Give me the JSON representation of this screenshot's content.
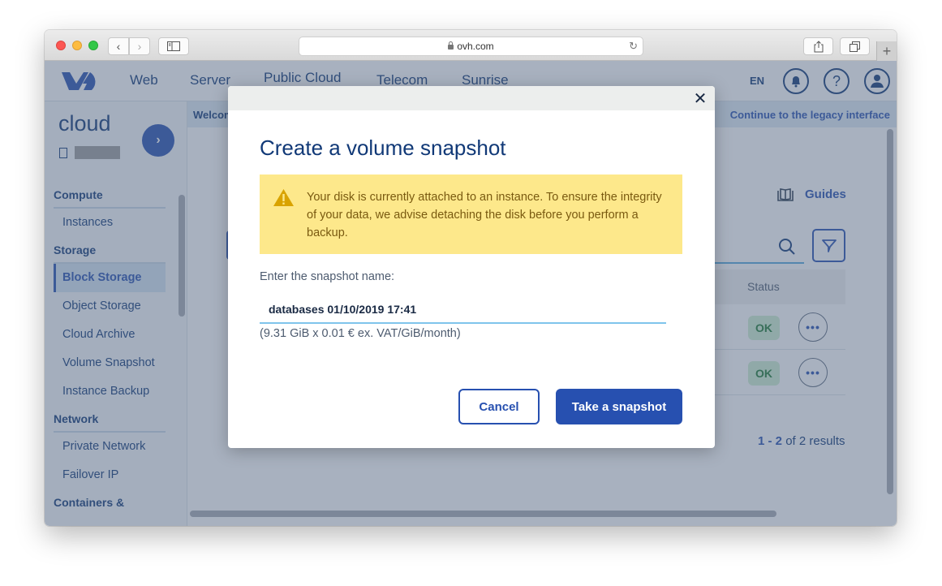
{
  "browser": {
    "url": "ovh.com",
    "back_label": "‹",
    "forward_label": "›",
    "new_tab_label": "+"
  },
  "topnav": {
    "items": [
      {
        "label": "Web"
      },
      {
        "label": "Server"
      },
      {
        "label": "Public Cloud"
      },
      {
        "label": "Telecom"
      },
      {
        "label": "Sunrise"
      }
    ],
    "language": "EN",
    "help_glyph": "?"
  },
  "leftnav": {
    "title": "cloud",
    "go_glyph": "›",
    "sections": [
      {
        "label": "Compute",
        "items": [
          {
            "label": "Instances"
          }
        ]
      },
      {
        "label": "Storage",
        "items": [
          {
            "label": "Block Storage",
            "active": true
          },
          {
            "label": "Object Storage"
          },
          {
            "label": "Cloud Archive"
          },
          {
            "label": "Volume Snapshot"
          },
          {
            "label": "Instance Backup"
          }
        ]
      },
      {
        "label": "Network",
        "items": [
          {
            "label": "Private Network"
          },
          {
            "label": "Failover IP"
          }
        ]
      },
      {
        "label": "Containers &",
        "items": []
      }
    ]
  },
  "banner": {
    "welcome": "Welcome",
    "legacy_link": "Continue to the legacy interface"
  },
  "content": {
    "guides_label": "Guides",
    "table": {
      "status_header": "Status",
      "rows": [
        {
          "status": "OK",
          "more": "•••"
        },
        {
          "status": "OK",
          "more": "•••"
        }
      ]
    },
    "pagination": {
      "range": "1 - 2",
      "total_text": "of 2 results"
    }
  },
  "modal": {
    "close_glyph": "✕",
    "title": "Create a volume snapshot",
    "warning": "Your disk is currently attached to an instance. To ensure the integrity of your data, we advise detaching the disk before you perform a backup.",
    "name_label": "Enter the snapshot name:",
    "name_value": "databases 01/10/2019 17:41",
    "price_note": "(9.31 GiB x 0.01 € ex. VAT/GiB/month)",
    "cancel_label": "Cancel",
    "submit_label": "Take a snapshot"
  },
  "colors": {
    "brand_blue": "#2750b0",
    "navy_text": "#113977",
    "warning_bg": "#fde88b",
    "ok_bg": "#cfeed1",
    "ok_text": "#1e7b34"
  }
}
